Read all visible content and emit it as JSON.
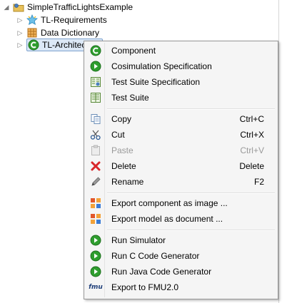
{
  "tree": {
    "root": {
      "label": "SimpleTrafficLightsExample",
      "icon": "project-folder-icon"
    },
    "children": [
      {
        "label": "TL-Requirements",
        "icon": "requirements-star-icon"
      },
      {
        "label": "Data Dictionary",
        "icon": "data-dictionary-icon"
      },
      {
        "label": "TL-Architecture",
        "icon": "component-architecture-icon",
        "selected": true
      }
    ]
  },
  "menu": {
    "groups": [
      {
        "items": [
          {
            "label": "Component",
            "shortcut": "",
            "icon": "component-icon",
            "enabled": true
          },
          {
            "label": "Cosimulation Specification",
            "shortcut": "",
            "icon": "cosimulation-icon",
            "enabled": true
          },
          {
            "label": "Test Suite Specification",
            "shortcut": "",
            "icon": "test-suite-spec-icon",
            "enabled": true
          },
          {
            "label": "Test Suite",
            "shortcut": "",
            "icon": "test-suite-icon",
            "enabled": true
          }
        ]
      },
      {
        "items": [
          {
            "label": "Copy",
            "shortcut": "Ctrl+C",
            "icon": "copy-icon",
            "enabled": true
          },
          {
            "label": "Cut",
            "shortcut": "Ctrl+X",
            "icon": "cut-icon",
            "enabled": true
          },
          {
            "label": "Paste",
            "shortcut": "Ctrl+V",
            "icon": "paste-icon",
            "enabled": false
          },
          {
            "label": "Delete",
            "shortcut": "Delete",
            "icon": "delete-icon",
            "enabled": true
          },
          {
            "label": "Rename",
            "shortcut": "F2",
            "icon": "rename-icon",
            "enabled": true
          }
        ]
      },
      {
        "items": [
          {
            "label": "Export component as image ...",
            "shortcut": "",
            "icon": "export-image-icon",
            "enabled": true
          },
          {
            "label": "Export model as document ...",
            "shortcut": "",
            "icon": "export-document-icon",
            "enabled": true
          }
        ]
      },
      {
        "items": [
          {
            "label": "Run Simulator",
            "shortcut": "",
            "icon": "run-simulator-icon",
            "enabled": true
          },
          {
            "label": "Run C Code Generator",
            "shortcut": "",
            "icon": "run-c-codegen-icon",
            "enabled": true
          },
          {
            "label": "Run Java Code Generator",
            "shortcut": "",
            "icon": "run-java-codegen-icon",
            "enabled": true
          },
          {
            "label": "Export to FMU2.0",
            "shortcut": "",
            "icon": "fmu-export-icon",
            "enabled": true
          }
        ]
      }
    ]
  },
  "colors": {
    "menu_bg": "#f5f5f5",
    "menu_border": "#979797",
    "selection_border": "#7da2ce",
    "selection_bg": "#dce8f6",
    "green_icon": "#2f9e2f",
    "delete_red": "#d9262a",
    "disabled_text": "#9a9a9a"
  },
  "fmu_icon_text": "fmu"
}
